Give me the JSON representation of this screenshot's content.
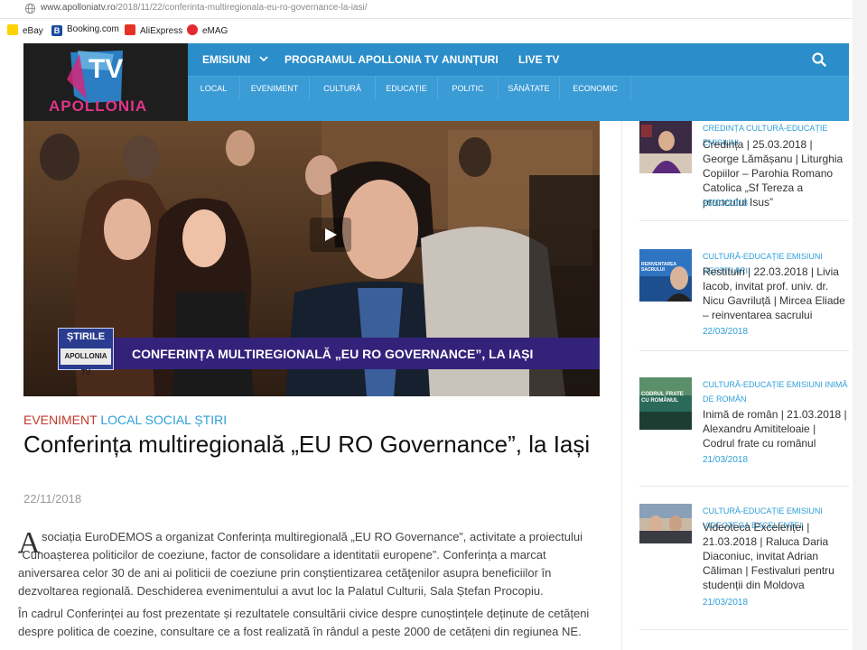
{
  "browser": {
    "url_host": "www.apolloniatv.ro",
    "url_path": "/2018/11/22/conferinta-multiregionala-eu-ro-governance-la-iasi/",
    "bookmarks": [
      {
        "label": "eBay",
        "icon": "ebay-icon",
        "color": "#f0a500"
      },
      {
        "label": "Booking.com",
        "icon": "booking-icon",
        "color": "#1b4aa0"
      },
      {
        "label": "AliExpress",
        "icon": "aliexpress-icon",
        "color": "#e43225"
      },
      {
        "label": "eMAG",
        "icon": "emag-icon",
        "color": "#e52a2f"
      }
    ]
  },
  "site": {
    "logo_tv": "TV",
    "logo_name": "APOLLONIA",
    "nav_main": [
      {
        "label": "EMISIUNI",
        "has_dropdown": true
      },
      {
        "label": "PROGRAMUL APOLLONIA TV"
      },
      {
        "label": "ANUNȚURI"
      },
      {
        "label": "LIVE TV"
      }
    ],
    "nav_sub": [
      "LOCAL",
      "EVENIMENT",
      "CULTURĂ",
      "EDUCAȚIE",
      "POLITIC",
      "SĂNĂTATE",
      "ECONOMIC"
    ],
    "colors": {
      "nav_primary": "#2b8dc9",
      "nav_secondary": "#3a9bd5",
      "accent_red": "#c0392b",
      "accent_blue": "#2e9fd8"
    }
  },
  "video": {
    "lower_third_title": "CONFERINȚA MULTIREGIONALĂ „EU RO GOVERNANCE”, LA IAȘI",
    "badge_title": "ȘTIRILE",
    "badge_sub": "APOLLONIA TV"
  },
  "article": {
    "categories": [
      {
        "label": "EVENIMENT",
        "color": "#c0392b"
      },
      {
        "label": "LOCAL",
        "color": "#2e9fd8"
      },
      {
        "label": "SOCIAL",
        "color": "#2e9fd8"
      },
      {
        "label": "ȘTIRI",
        "color": "#2e9fd8"
      }
    ],
    "title": "Conferința multiregională „EU RO Governance”, la Iași",
    "date": "22/11/2018",
    "dropcap": "A",
    "paragraph1": "sociația EuroDEMOS a organizat Conferința multiregională „EU RO Governance”, activitate a proiectului “Cunoașterea politicilor de coeziune, factor de consolidare a identitatii europene”. Conferința a marcat aniversarea celor 30 de ani ai politicii de coeziune prin conştientizarea cetăţenilor asupra beneficiilor în dezvoltarea regională. Deschiderea evenimentului a avut loc la Palatul Culturii, Sala Ștefan Procopiu.",
    "paragraph2": "În cadrul Conferinței au fost prezentate și rezultatele consultării civice despre cunoștințele deținute de cetățeni despre politica de coezine, consultare ce a fost realizată în rândul a peste 2000 de cetățeni din regiunea NE."
  },
  "sidebar": [
    {
      "cats": "CREDINȚA CULTURĂ-EDUCAȚIE EMISIUNI",
      "title": "Credința | 25.03.2018 | George Lămășanu | Liturghia Copiilor – Parohia Romano Catolica „Sf Tereza a pruncului Isus”",
      "date": "25/03/2018"
    },
    {
      "cats": "CULTURĂ-EDUCAȚIE EMISIUNI RESTITUIRI",
      "title": "Restituiri | 22.03.2018 | Livia Iacob, invitat prof. univ. dr. Nicu Gavriluță | Mircea Eliade – reinventarea sacrului",
      "date": "22/03/2018",
      "thumb_text": "REINVENTAREA SACRULUI"
    },
    {
      "cats": "CULTURĂ-EDUCAȚIE EMISIUNI INIMĂ DE ROMÂN",
      "title": "Inimă de român | 21.03.2018 | Alexandru Amititeloaie | Codrul frate cu românul",
      "date": "21/03/2018",
      "thumb_text": "CODRUL FRATE CU ROMÂNUL"
    },
    {
      "cats": "CULTURĂ-EDUCAȚIE EMISIUNI VIDEOTECA EXCELENȚEI",
      "title": "Videoteca Excelenței | 21.03.2018 | Raluca Daria Diaconiuc, invitat Adrian Căliman | Festivaluri pentru studenții din Moldova",
      "date": "21/03/2018"
    }
  ]
}
